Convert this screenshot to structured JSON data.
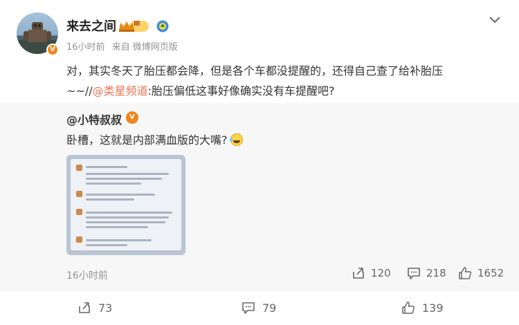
{
  "post": {
    "username": "来去之间",
    "level_badge": "Ⅲ",
    "avatar_badge": "V",
    "time": "16小时前",
    "source_prefix": "来自",
    "source": "微博网页版",
    "text_main": "对，其实冬天了胎压都会降，但是各个车都没提醒的，还得自己查了给补胎压",
    "text_repost_prefix": "~~//",
    "text_mention": "@类星频道",
    "text_repost_rest": ":胎压偏低这事好像确实没有车提醒吧?"
  },
  "retweet": {
    "username": "@小特叔叔",
    "badge": "V",
    "text": "卧槽，这就是内部满血版的大嘴?",
    "time": "16小时前",
    "reposts": "120",
    "comments": "218",
    "likes": "1652"
  },
  "actions": {
    "reposts": "73",
    "comments": "79",
    "likes": "139"
  },
  "colors": {
    "link": "#eb7350",
    "badge": "#f2841c",
    "retweet_bg": "#f7f7f7"
  }
}
